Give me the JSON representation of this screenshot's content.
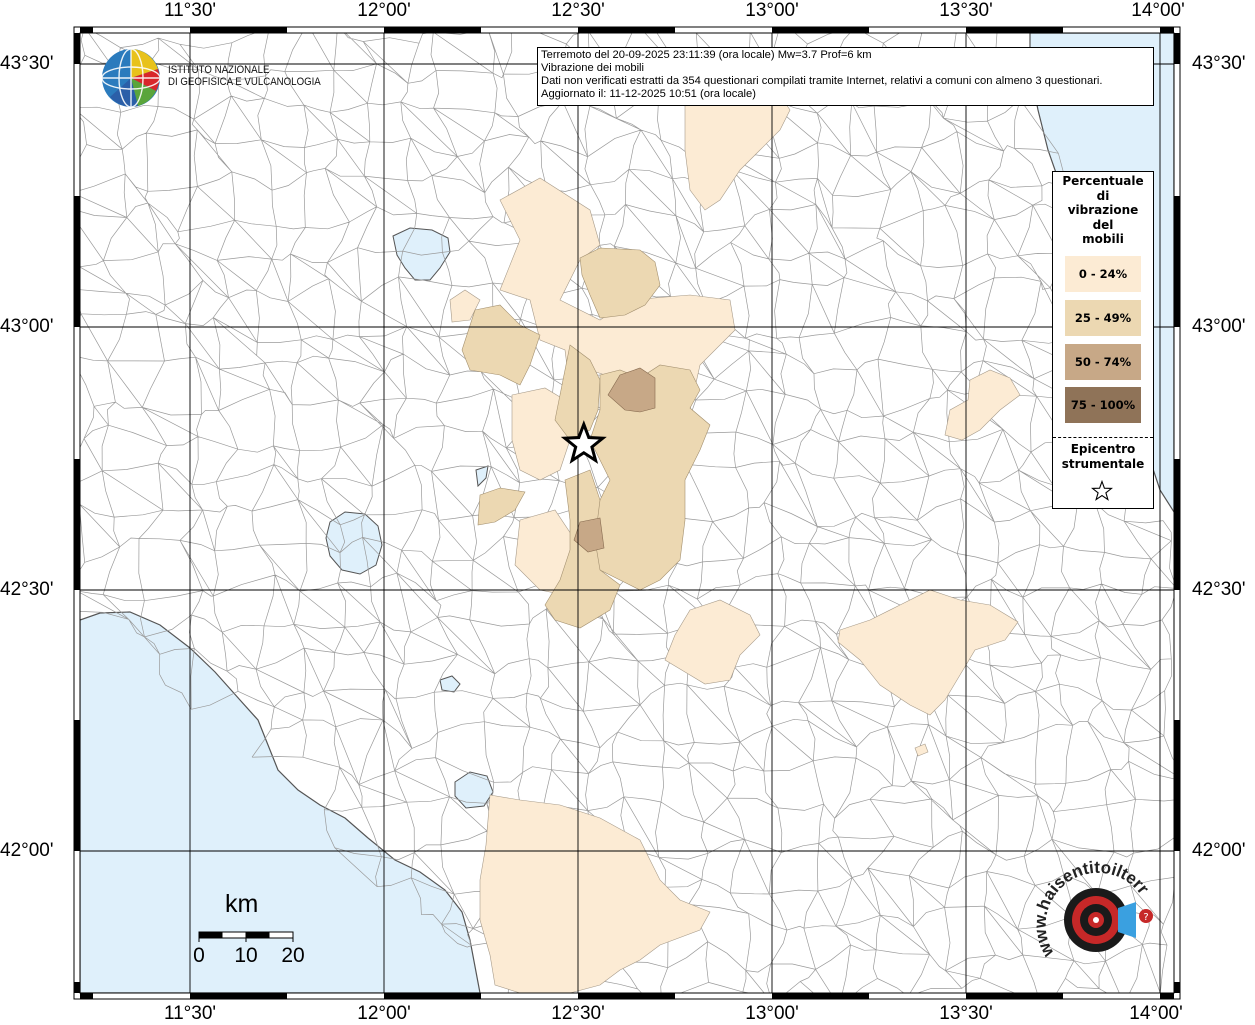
{
  "map": {
    "longitude_ticks": [
      "11°30'",
      "12°00'",
      "12°30'",
      "13°00'",
      "13°30'",
      "14°00'"
    ],
    "latitude_ticks": [
      "43°30'",
      "43°00'",
      "42°30'",
      "42°00'"
    ],
    "epicenter": {
      "lon": 12.515,
      "lat": 42.775
    },
    "colors": {
      "sea": "#dff0fb",
      "border": "#9a9a9a",
      "grid": "#000000"
    }
  },
  "info_box": {
    "line1": "Terremoto del 20-09-2025 23:11:39 (ora locale) Mw=3.7 Prof=6 km",
    "line2": "Vibrazione dei mobili",
    "line3": "Dati non verificati estratti da 354 questionari compilati tramite Internet, relativi a comuni con almeno 3 questionari.",
    "line4": "Aggiornato il: 11-12-2025 10:51 (ora locale)"
  },
  "logo": {
    "line1": "ISTITUTO NAZIONALE",
    "line2": "DI GEOFISICA E VULCANOLOGIA"
  },
  "legend": {
    "title": [
      "Percentuale",
      "di",
      "vibrazione",
      "del",
      "mobili"
    ],
    "classes": [
      {
        "label": "0 - 24%",
        "color": "#fcebd4"
      },
      {
        "label": "25 - 49%",
        "color": "#ecd8b2"
      },
      {
        "label": "50 - 74%",
        "color": "#c7a887"
      },
      {
        "label": "75 - 100%",
        "color": "#8f7358"
      }
    ],
    "epicenter_label": [
      "Epicentro",
      "strumentale"
    ]
  },
  "scale": {
    "unit": "km",
    "labels": [
      "0",
      "10",
      "20"
    ]
  },
  "hs_logo": {
    "text": "www.haisentitoilterremoto.it"
  }
}
